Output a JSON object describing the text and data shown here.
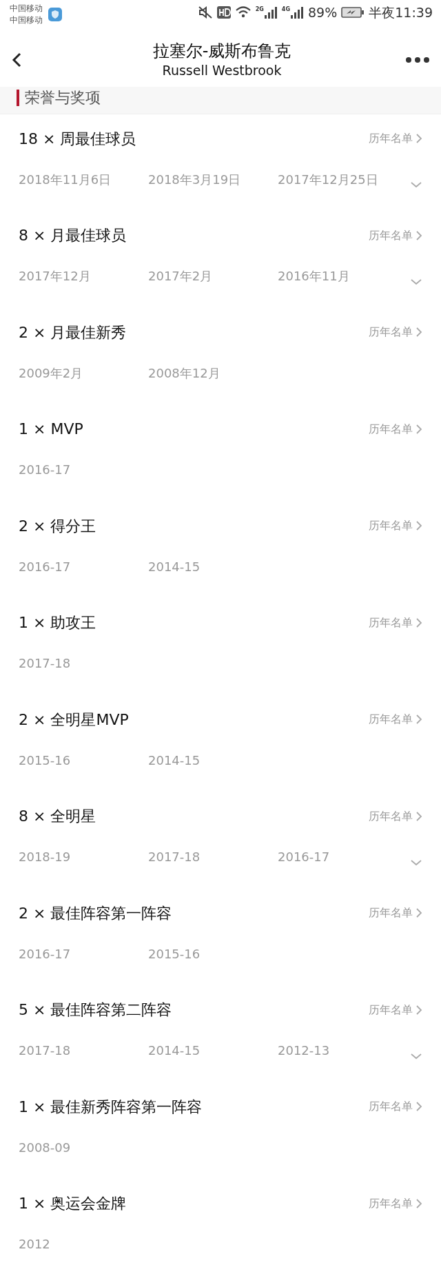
{
  "status_bar": {
    "carriers": [
      "中国移动",
      "中国移动"
    ],
    "battery": "89%",
    "time": "半夜11:39",
    "network_labels": [
      "2G",
      "4G"
    ]
  },
  "header": {
    "title": "拉塞尔-威斯布鲁克",
    "subtitle": "Russell Westbrook"
  },
  "section": {
    "title": "荣誉与奖项"
  },
  "awards": [
    {
      "title": "18 × 周最佳球员",
      "link": "历年名单",
      "dates": [
        "2018年11月6日",
        "2018年3月19日",
        "2017年12月25日"
      ],
      "expandable": true
    },
    {
      "title": "8 × 月最佳球员",
      "link": "历年名单",
      "dates": [
        "2017年12月",
        "2017年2月",
        "2016年11月"
      ],
      "expandable": true
    },
    {
      "title": "2 × 月最佳新秀",
      "link": "历年名单",
      "dates": [
        "2009年2月",
        "2008年12月"
      ],
      "expandable": false
    },
    {
      "title": "1 × MVP",
      "link": "历年名单",
      "dates": [
        "2016-17"
      ],
      "expandable": false
    },
    {
      "title": "2 × 得分王",
      "link": "历年名单",
      "dates": [
        "2016-17",
        "2014-15"
      ],
      "expandable": false
    },
    {
      "title": "1 × 助攻王",
      "link": "历年名单",
      "dates": [
        "2017-18"
      ],
      "expandable": false
    },
    {
      "title": "2 × 全明星MVP",
      "link": "历年名单",
      "dates": [
        "2015-16",
        "2014-15"
      ],
      "expandable": false
    },
    {
      "title": "8 × 全明星",
      "link": "历年名单",
      "dates": [
        "2018-19",
        "2017-18",
        "2016-17"
      ],
      "expandable": true
    },
    {
      "title": "2 × 最佳阵容第一阵容",
      "link": "历年名单",
      "dates": [
        "2016-17",
        "2015-16"
      ],
      "expandable": false
    },
    {
      "title": "5 × 最佳阵容第二阵容",
      "link": "历年名单",
      "dates": [
        "2017-18",
        "2014-15",
        "2012-13"
      ],
      "expandable": true
    },
    {
      "title": "1 × 最佳新秀阵容第一阵容",
      "link": "历年名单",
      "dates": [
        "2008-09"
      ],
      "expandable": false
    },
    {
      "title": "1 × 奥运会金牌",
      "link": "历年名单",
      "dates": [
        "2012"
      ],
      "expandable": false
    }
  ]
}
